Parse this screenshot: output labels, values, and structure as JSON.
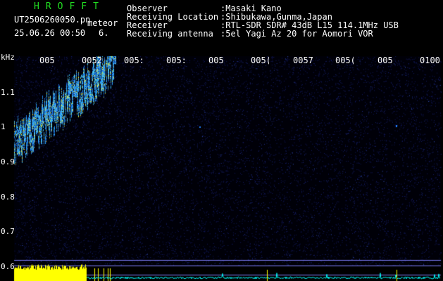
{
  "header": {
    "brand": "HROFFT",
    "filename": "UT2506260050.pn",
    "meteor_label": "meteor",
    "datetime": "25.06.26 00:50",
    "count": "6.",
    "observer_label": "Observer",
    "observer_value": ":Masaki Kano",
    "location_label": "Receiving Location",
    "location_value": ":Shibukawa,Gunma,Japan",
    "receiver_label": "Receiver",
    "receiver_value": ":RTL-SDR SDR# 43dB L15 114.1MHz USB",
    "antenna_label": "Receiving antenna",
    "antenna_value": ":5el Yagi Az 20 for Aomori VOR"
  },
  "axis": {
    "unit": "kHz",
    "y_ticks": [
      "1.1",
      "1",
      "0.9",
      "0.8",
      "0.7",
      "0.6"
    ],
    "x_ticks": [
      "005",
      "0052",
      "005:",
      "005:",
      "005",
      "005(",
      "0057",
      "005(",
      "005",
      "0100"
    ]
  },
  "colors": {
    "background": "#000000",
    "text": "#ffffff",
    "brand": "#22dd22",
    "noise": "#1a2a8a",
    "signal_hot": "#ffff40",
    "signal_mid": "#40d0ff",
    "signal_low": "#2080ff",
    "bar_fill": "#ffff00",
    "trace": "#00ffff",
    "guide": "#8080ff"
  }
}
